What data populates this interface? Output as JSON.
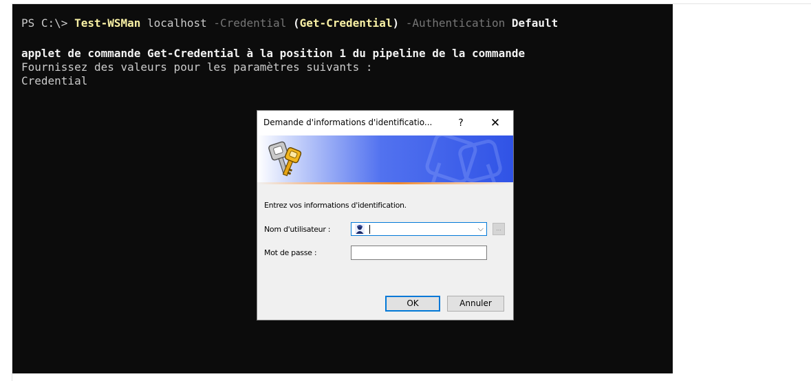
{
  "terminal": {
    "prompt": "PS C:\\> ",
    "cmdlet": "Test-WSMan",
    "target": " localhost ",
    "param_credential": "-Credential",
    "open_paren": " (",
    "inner_cmdlet": "Get-Credential",
    "close_paren": ")",
    "param_auth": " -Authentication",
    "auth_value": " Default",
    "line2": "applet de commande Get-Credential à la position 1 du pipeline de la commande",
    "line3": "Fournissez des valeurs pour les paramètres suivants :",
    "line4": "Credential"
  },
  "dialog": {
    "title": "Demande d'informations d'identificatio...",
    "help_label": "?",
    "close_label": "✕",
    "instruction": "Entrez vos informations d'identification.",
    "username_label": "Nom d'utilisateur :",
    "username_value": "",
    "password_label": "Mot de passe :",
    "browse_label": "...",
    "ok_label": "OK",
    "cancel_label": "Annuler"
  },
  "colors": {
    "terminal_bg": "#0c0c0c",
    "cmdlet_yellow": "#f9f1a5",
    "param_gray": "#767676",
    "banner_blue": "#3053e6",
    "accent_orange": "#f08a30",
    "focus_blue": "#0078d7"
  }
}
